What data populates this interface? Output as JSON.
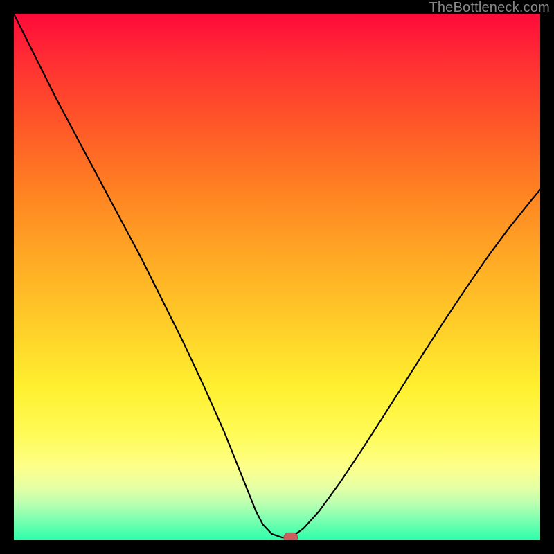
{
  "watermark": "TheBottleneck.com",
  "colors": {
    "frame": "#000000",
    "curve": "#000000",
    "marker_fill": "#cc5e5e",
    "marker_stroke": "#b24848",
    "gradient_top": "#ff0a3a",
    "gradient_bottom": "#2cffab"
  },
  "chart_data": {
    "type": "line",
    "title": "",
    "xlabel": "",
    "ylabel": "",
    "xlim": [
      0,
      100
    ],
    "ylim": [
      0,
      100
    ],
    "grid": false,
    "series": [
      {
        "name": "left-branch",
        "x": [
          0,
          4,
          8,
          12,
          16,
          20,
          24,
          28,
          32,
          36,
          40,
          42,
          44,
          46,
          47.3,
          49,
          51,
          52.6
        ],
        "y": [
          100,
          92,
          84,
          76.5,
          69,
          61.5,
          54,
          46,
          38,
          29.5,
          20.5,
          15.5,
          10.5,
          5.5,
          3,
          1.2,
          0.5,
          0.5
        ]
      },
      {
        "name": "right-branch",
        "x": [
          52.6,
          55,
          58,
          62,
          66,
          70,
          74,
          78,
          82,
          86,
          90,
          94,
          98,
          100
        ],
        "y": [
          0.5,
          2.2,
          5.5,
          11,
          17,
          23.2,
          29.5,
          35.8,
          42,
          48,
          53.8,
          59.2,
          64.2,
          66.6
        ]
      }
    ],
    "marker": {
      "x": 52.6,
      "y": 0.5,
      "shape": "rounded-pill"
    }
  }
}
